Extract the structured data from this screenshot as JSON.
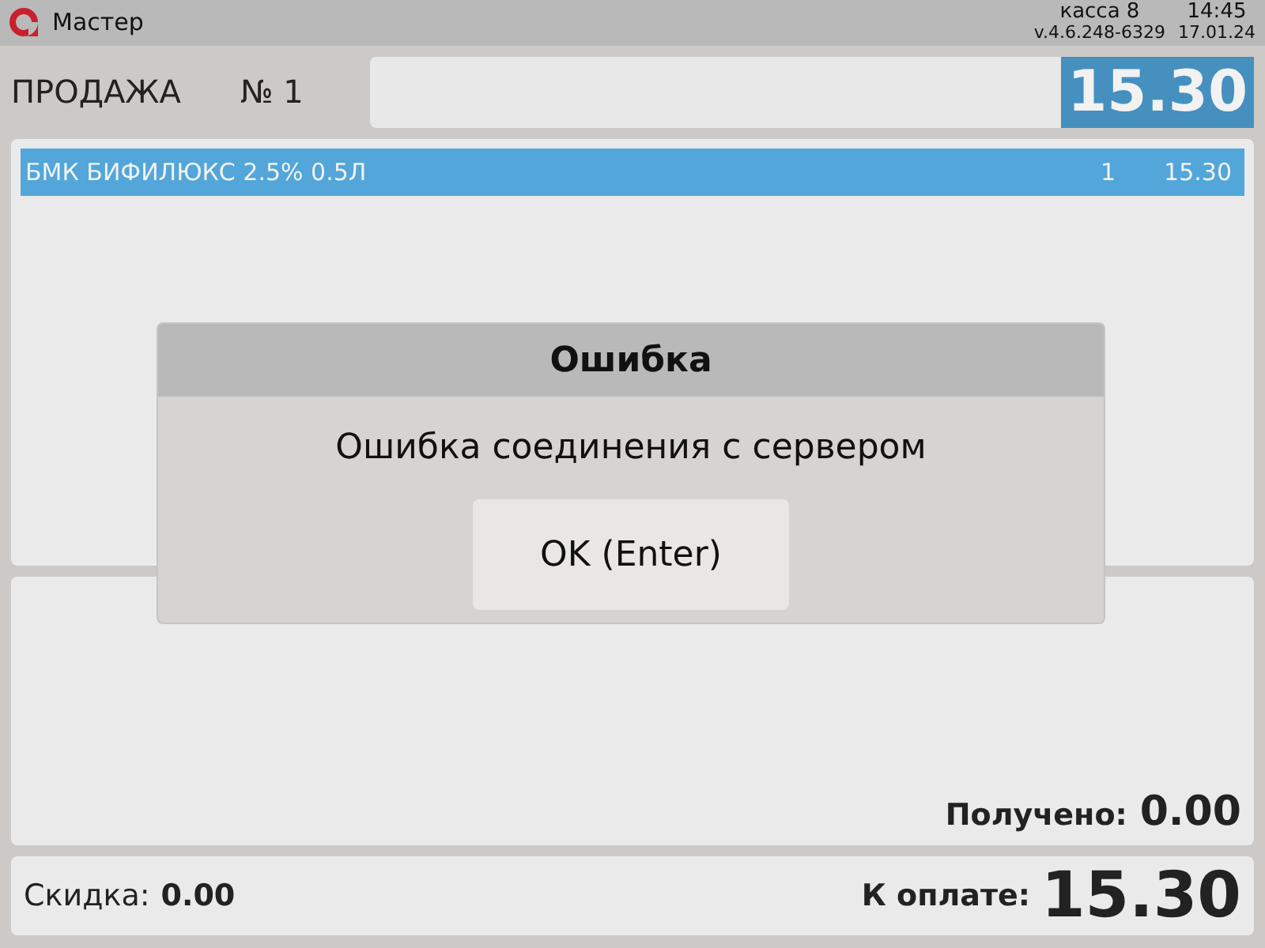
{
  "header": {
    "app_name": "Мастер",
    "register": "касса 8",
    "time": "14:45",
    "version": "v.4.6.248-6329",
    "date": "17.01.24"
  },
  "sale": {
    "title": "ПРОДАЖА",
    "number": "№ 1",
    "total": "15.30"
  },
  "receipt_rows": [
    {
      "name": "БМК БИФИЛЮКС 2.5% 0.5Л",
      "quantity": "1",
      "sum": "15.30",
      "selected": true
    }
  ],
  "payment": {
    "received_label": "Получено:",
    "received_value": "0.00"
  },
  "footer": {
    "discount_label": "Скидка:",
    "discount_value": "0.00",
    "due_label": "К оплате:",
    "due_value": "15.30"
  },
  "dialog": {
    "title": "Ошибка",
    "message": "Ошибка соединения с сервером",
    "button": "OK (Enter)"
  }
}
